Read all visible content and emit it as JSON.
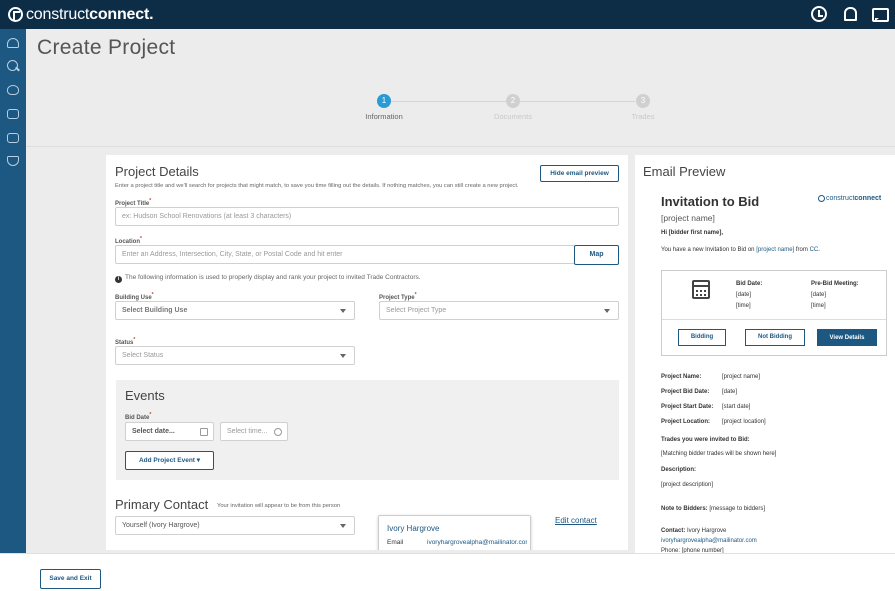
{
  "header": {
    "logo_light": "construct",
    "logo_bold": "connect.",
    "icons": [
      "history-icon",
      "bell-icon",
      "chat-icon"
    ]
  },
  "sidebar": {
    "icons": [
      "dashboard-icon",
      "search-icon",
      "heart-icon",
      "mail-icon",
      "document-icon",
      "shield-icon"
    ]
  },
  "page": {
    "title": "Create Project"
  },
  "stepper": {
    "steps": [
      {
        "number": "1",
        "label": "Information",
        "active": true
      },
      {
        "number": "2",
        "label": "Documents",
        "active": false
      },
      {
        "number": "3",
        "label": "Trades",
        "active": false
      }
    ]
  },
  "project_details": {
    "title": "Project Details",
    "hint": "Enter a project title and we'll search for projects that might match, to save you time filling out the details. If nothing matches, you can still create a new project.",
    "hide_preview_button": "Hide email preview",
    "project_title_label": "Project Title",
    "project_title_placeholder": "ex: Hudson School Renovations (at least 3 characters)",
    "location_label": "Location",
    "location_placeholder": "Enter an Address, Intersection, City, State, or Postal Code and hit enter",
    "map_button": "Map",
    "info_text": "The following information is used to properly display and rank your project to invited Trade Contractors.",
    "building_use_label": "Building Use",
    "building_use_value": "Select Building Use",
    "project_type_label": "Project Type",
    "project_type_value": "Select Project Type",
    "status_label": "Status",
    "status_value": "Select Status",
    "required_mark": "*"
  },
  "events": {
    "title": "Events",
    "bid_date_label": "Bid Date",
    "date_placeholder": "Select date...",
    "time_placeholder": "Select time...",
    "add_event_button": "Add Project Event ▾"
  },
  "primary_contact": {
    "title": "Primary Contact",
    "note": "Your invitation will appear to be from this person",
    "selected": "Yourself (Ivory Hargrove)",
    "card_name": "Ivory Hargrove",
    "card_email_label": "Email",
    "card_email_value": "ivoryhargrovealpha@mailinator.com",
    "edit_link": "Edit contact"
  },
  "email_preview": {
    "title": "Email Preview",
    "logo_light": "construct",
    "logo_bold": "connect",
    "heading": "Invitation to Bid",
    "project_name_tag": "[project name]",
    "greeting": "Hi [bidder first name],",
    "intro_a": "You have a new Invitation to Bid on ",
    "intro_link": "[project name]",
    "intro_b": " from ",
    "intro_cc": "CC",
    "intro_end": ".",
    "bid_date_label": "Bid Date:",
    "bid_date_value": "[date]",
    "bid_time_value": "[time]",
    "prebid_label": "Pre-Bid Meeting:",
    "prebid_date_value": "[date]",
    "prebid_time_value": "[time]",
    "btn_bidding": "Bidding",
    "btn_not_bidding": "Not Bidding",
    "btn_view_details": "View Details",
    "fields": [
      {
        "label": "Project Name:",
        "value": "[project name]"
      },
      {
        "label": "Project Bid Date:",
        "value": "[date]"
      },
      {
        "label": "Project Start Date:",
        "value": "[start date]"
      },
      {
        "label": "Project Location:",
        "value": "[project location]"
      }
    ],
    "trades_label": "Trades you were invited to Bid:",
    "trades_value": "[Matching bidder trades will be shown here]",
    "description_label": "Description:",
    "description_value": "[project description]",
    "note_label": "Note to Bidders:",
    "note_value": "[message to bidders]",
    "contact_label": "Contact:",
    "contact_name": "Ivory Hargrove",
    "contact_email": "ivoryhargrovealpha@mailinator.com",
    "contact_phone_partial": "Phone: [phone number]"
  },
  "footer": {
    "save_exit_button": "Save and Exit"
  },
  "colors": {
    "topbar": "#0d2d47",
    "sidebar": "#1d5883",
    "accent": "#2a9ad6",
    "brand": "#1d5883"
  }
}
